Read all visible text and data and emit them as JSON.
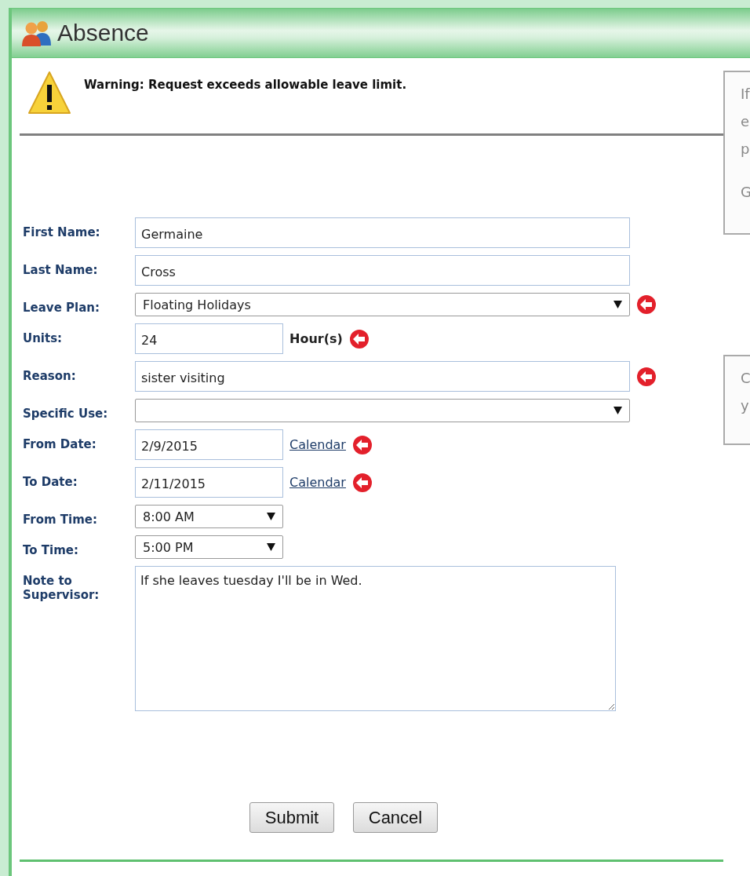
{
  "window": {
    "title": "Absence"
  },
  "warning": {
    "message": "Warning: Request exceeds allowable leave limit."
  },
  "form": {
    "fields": [
      {
        "label": "First Name:",
        "kind": "text",
        "value": "Germaine",
        "required": false
      },
      {
        "label": "Last Name:",
        "kind": "text",
        "value": "Cross",
        "required": false
      },
      {
        "label": "Leave Plan:",
        "kind": "select",
        "value": "Floating Holidays",
        "required": true
      },
      {
        "label": "Units:",
        "kind": "short_text",
        "value": "24",
        "unit": "Hour(s)",
        "required": true
      },
      {
        "label": "Reason:",
        "kind": "text",
        "value": "sister visiting",
        "required": true
      },
      {
        "label": "Specific Use:",
        "kind": "select",
        "required": false
      },
      {
        "label": "From Date:",
        "kind": "short_text",
        "value": "2/9/2015",
        "link": "Calendar",
        "required": true
      },
      {
        "label": "To Date:",
        "kind": "short_text",
        "value": "2/11/2015",
        "link": "Calendar",
        "required": true
      },
      {
        "label": "From Time:",
        "kind": "short_select",
        "value": "8:00 AM",
        "required": false
      },
      {
        "label": "To Time:",
        "kind": "short_select",
        "value": "5:00 PM",
        "required": false
      },
      {
        "label": "Note to Supervisor:",
        "kind": "textarea",
        "value": "If she leaves tuesday I'll be in Wed.",
        "required": false
      }
    ],
    "buttons": [
      "Submit",
      "Cancel"
    ]
  },
  "side_panels": [
    {
      "paragraphs": [
        [
          "If",
          "e",
          "p"
        ],
        [
          "G"
        ]
      ]
    },
    {
      "paragraphs": [
        [
          "C",
          "y"
        ]
      ]
    }
  ]
}
